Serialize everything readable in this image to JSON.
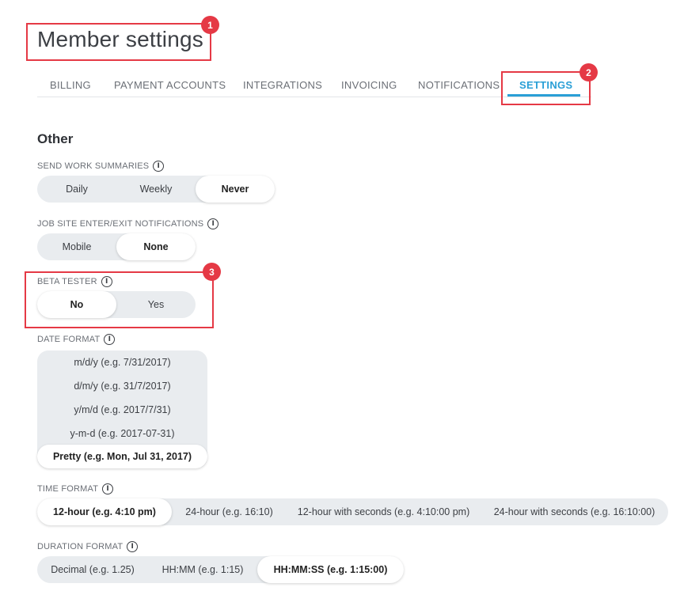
{
  "page": {
    "title": "Member settings"
  },
  "tabs": [
    {
      "label": "BILLING",
      "active": false
    },
    {
      "label": "PAYMENT ACCOUNTS",
      "active": false
    },
    {
      "label": "INTEGRATIONS",
      "active": false
    },
    {
      "label": "INVOICING",
      "active": false
    },
    {
      "label": "NOTIFICATIONS",
      "active": false
    },
    {
      "label": "SETTINGS",
      "active": true
    }
  ],
  "section": {
    "title": "Other"
  },
  "fields": {
    "work_summaries": {
      "label": "SEND WORK SUMMARIES",
      "options": [
        "Daily",
        "Weekly",
        "Never"
      ],
      "selected": "Never"
    },
    "job_site": {
      "label": "JOB SITE ENTER/EXIT NOTIFICATIONS",
      "options": [
        "Mobile",
        "None"
      ],
      "selected": "None"
    },
    "beta_tester": {
      "label": "BETA TESTER",
      "options": [
        "No",
        "Yes"
      ],
      "selected": "No"
    },
    "date_format": {
      "label": "DATE FORMAT",
      "options": [
        "m/d/y (e.g. 7/31/2017)",
        "d/m/y (e.g. 31/7/2017)",
        "y/m/d (e.g. 2017/7/31)",
        "y-m-d (e.g. 2017-07-31)",
        "Pretty (e.g. Mon, Jul 31, 2017)"
      ],
      "selected": "Pretty (e.g. Mon, Jul 31, 2017)"
    },
    "time_format": {
      "label": "TIME FORMAT",
      "options": [
        "12-hour (e.g. 4:10 pm)",
        "24-hour (e.g. 16:10)",
        "12-hour with seconds (e.g. 4:10:00 pm)",
        "24-hour with seconds (e.g. 16:10:00)"
      ],
      "selected": "12-hour (e.g. 4:10 pm)"
    },
    "duration_format": {
      "label": "DURATION FORMAT",
      "options": [
        "Decimal (e.g. 1.25)",
        "HH:MM (e.g. 1:15)",
        "HH:MM:SS (e.g. 1:15:00)"
      ],
      "selected": "HH:MM:SS (e.g. 1:15:00)"
    }
  },
  "info_icon": {
    "name": "info-icon",
    "glyph": "i"
  },
  "annotations": [
    "1",
    "2",
    "3"
  ],
  "colors": {
    "accent": "#2a9fd6",
    "annotation": "#e53945",
    "segment_bg": "#e9ecef"
  }
}
